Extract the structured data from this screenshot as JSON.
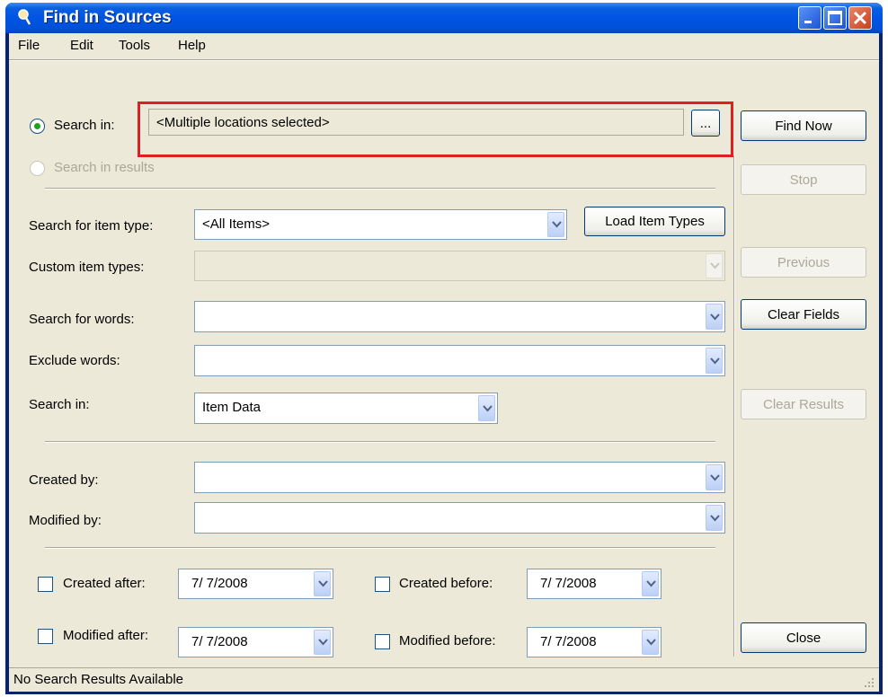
{
  "window": {
    "title": "Find in Sources"
  },
  "menu": {
    "items": [
      "File",
      "Edit",
      "Tools",
      "Help"
    ]
  },
  "search_in_radio": {
    "label": "Search in:",
    "selected": true,
    "value": "<Multiple locations selected>",
    "browse_label": "..."
  },
  "search_in_results_radio": {
    "label": "Search in results",
    "enabled": false
  },
  "item_type": {
    "label": "Search for item type:",
    "value": "<All Items>",
    "load_button": "Load Item Types"
  },
  "custom_item_types": {
    "label": "Custom item types:",
    "value": ""
  },
  "words": {
    "label": "Search for words:",
    "value": ""
  },
  "exclude": {
    "label": "Exclude words:",
    "value": ""
  },
  "search_scope": {
    "label": "Search in:",
    "value": "Item Data"
  },
  "created_by": {
    "label": "Created by:",
    "value": ""
  },
  "modified_by": {
    "label": "Modified by:",
    "value": ""
  },
  "dates": {
    "created_after": {
      "label": "Created after:",
      "value": "7/ 7/2008",
      "checked": false
    },
    "created_before": {
      "label": "Created before:",
      "value": "7/ 7/2008",
      "checked": false
    },
    "modified_after": {
      "label": "Modified after:",
      "value": "7/ 7/2008",
      "checked": false
    },
    "modified_before": {
      "label": "Modified before:",
      "value": "7/ 7/2008",
      "checked": false
    }
  },
  "buttons": {
    "find_now": "Find Now",
    "stop": "Stop",
    "previous": "Previous",
    "clear_fields": "Clear Fields",
    "clear_results": "Clear Results",
    "close": "Close"
  },
  "status": {
    "text": "No Search Results Available"
  },
  "colors": {
    "titlebar": "#0054e3",
    "client": "#ece9d8",
    "highlight": "#e02020",
    "radio_dot": "#21a121"
  }
}
